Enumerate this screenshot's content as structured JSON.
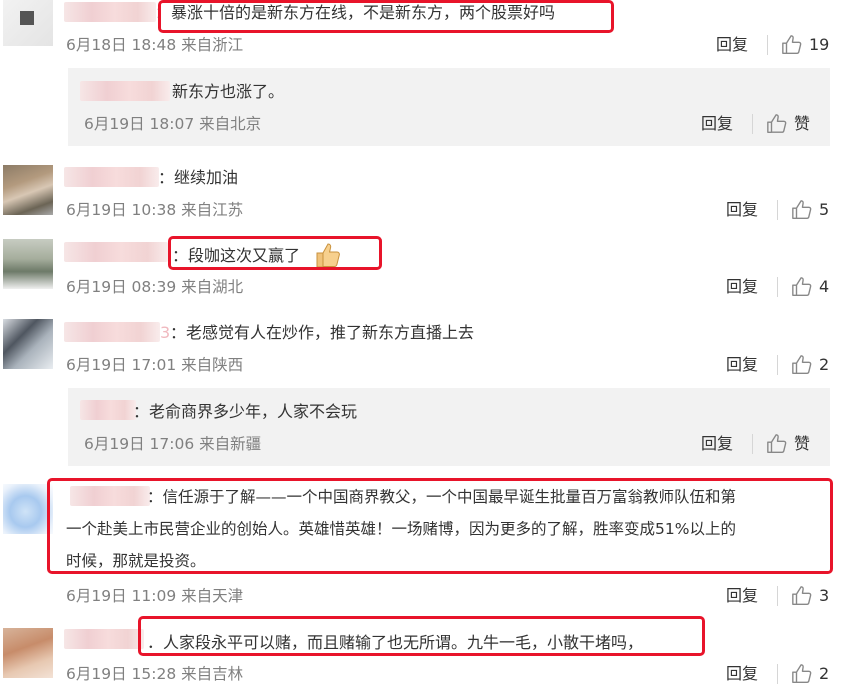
{
  "comments": [
    {
      "text": "：暴涨十倍的是新东方在线，不是新东方，两个股票好吗",
      "meta": "6月18日 18:48 来自浙江",
      "reply_label": "回复",
      "likes": "19"
    },
    {
      "text": "新东方也涨了。",
      "meta": "6月19日 18:07 来自北京",
      "reply_label": "回复",
      "likes": "赞"
    },
    {
      "text": "：继续加油",
      "meta": "6月19日 10:38 来自江苏",
      "reply_label": "回复",
      "likes": "5"
    },
    {
      "text": "：段咖这次又赢了",
      "meta": "6月19日 08:39 来自湖北",
      "reply_label": "回复",
      "likes": "4"
    },
    {
      "text": "：老感觉有人在炒作，推了新东方直播上去",
      "name_tail": "3",
      "meta": "6月19日 17:01 来自陕西",
      "reply_label": "回复",
      "likes": "2"
    },
    {
      "text": "：老俞商界多少年，人家不会玩",
      "meta": "6月19日 17:06 来自新疆",
      "reply_label": "回复",
      "likes": "赞"
    },
    {
      "line1": "：信任源于了解——一个中国商界教父，一个中国最早诞生批量百万富翁教师队伍和第",
      "line2": "一个赴美上市民营企业的创始人。英雄惜英雄！一场赌博，因为更多的了解，胜率变成51%以上的",
      "line3": "时候，那就是投资。",
      "meta": "6月19日 11:09 来自天津",
      "reply_label": "回复",
      "likes": "3"
    },
    {
      "text": "．人家段永平可以赌，而且赌输了也无所谓。九牛一毛，小散干堵吗，",
      "meta": "6月19日 15:28 来自吉林",
      "reply_label": "回复",
      "likes": "2"
    }
  ],
  "icons": {
    "like": "thumbs-up-icon",
    "emoji": "thumbs-up-emoji"
  },
  "colors": {
    "highlight": "#e8142a",
    "meta": "#808080",
    "subbox": "#f2f2f2"
  }
}
